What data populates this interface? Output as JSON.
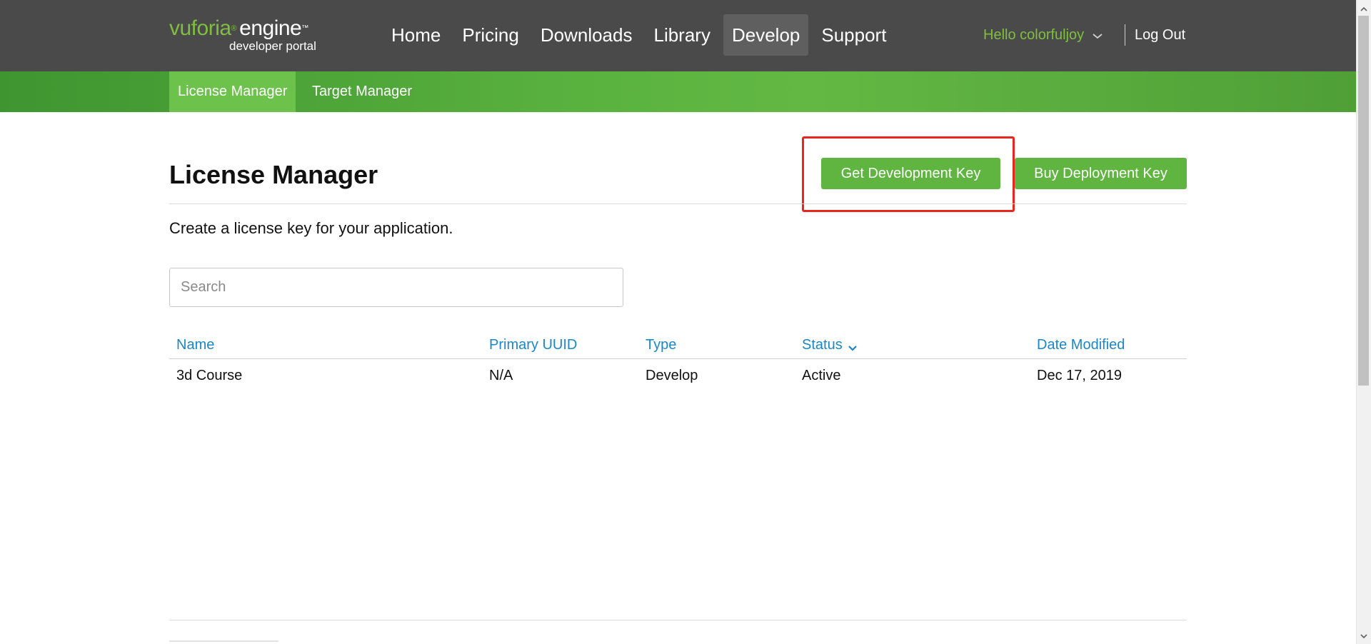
{
  "logo": {
    "brand": "vuforia",
    "reg": "®",
    "product": "engine",
    "tm": "™",
    "sub": "developer portal"
  },
  "nav": {
    "items": [
      {
        "label": "Home",
        "active": false
      },
      {
        "label": "Pricing",
        "active": false
      },
      {
        "label": "Downloads",
        "active": false
      },
      {
        "label": "Library",
        "active": false
      },
      {
        "label": "Develop",
        "active": true
      },
      {
        "label": "Support",
        "active": false
      }
    ]
  },
  "user": {
    "greeting": "Hello colorfuljoy",
    "dropdown_icon": "chevron-down-icon",
    "logout_label": "Log Out"
  },
  "subnav": {
    "items": [
      {
        "label": "License Manager",
        "active": true
      },
      {
        "label": "Target Manager",
        "active": false
      }
    ]
  },
  "main": {
    "title": "License Manager",
    "subtitle": "Create a license key for your application.",
    "buttons": {
      "get_dev_key": "Get Development Key",
      "buy_deploy_key": "Buy Deployment Key"
    },
    "highlight_color": "#e8251f"
  },
  "search": {
    "placeholder": "Search",
    "value": ""
  },
  "table": {
    "columns": [
      "Name",
      "Primary UUID",
      "Type",
      "Status",
      "Date Modified"
    ],
    "sorted_column": "Status",
    "sort_icon": "chevron-down-icon",
    "rows": [
      [
        "3d Course",
        "N/A",
        "Develop",
        "Active",
        "Dec 17, 2019"
      ]
    ]
  },
  "colors": {
    "topbar": "#4a4a4b",
    "accent_green": "#5fb53f",
    "brand_green": "#7fbf3f",
    "link_blue": "#1a87c9"
  }
}
